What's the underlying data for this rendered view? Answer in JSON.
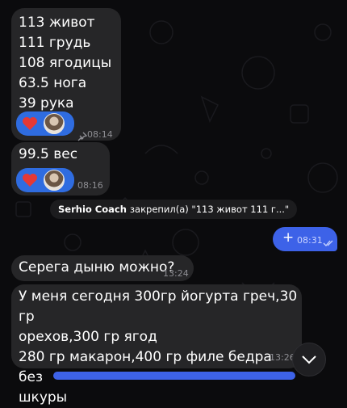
{
  "messages": [
    {
      "lines": "113 живот\n111 грудь\n108 ягодицы\n63.5 нога\n39 рука",
      "time": "08:14",
      "pinned": true
    },
    {
      "lines": "99.5 вес",
      "time": "08:16"
    }
  ],
  "service": {
    "author": "Serhio Coach",
    "text": "закрепил(а) \"113 живот 111 г...\""
  },
  "outgoing": {
    "text": "+",
    "time": "08:31"
  },
  "incoming2": {
    "text": "Серега дыню можно?",
    "time": "13:24"
  },
  "incoming3": {
    "text": "У меня сегодня 300гр йогурта греч,30 гр\nорехов,300 гр ягод\n280 гр макарон,400 гр филе бедра без\nшкуры",
    "time": "13:26"
  },
  "icons": {
    "reaction": "heart-icon",
    "pin": "pin-icon",
    "read": "double-check-icon",
    "scroll": "chevron-down-icon"
  },
  "colors": {
    "bubble": "#262628",
    "outgoing": "#3d62e8",
    "reaction": "#2f6ce0",
    "heart": "#e53935"
  }
}
